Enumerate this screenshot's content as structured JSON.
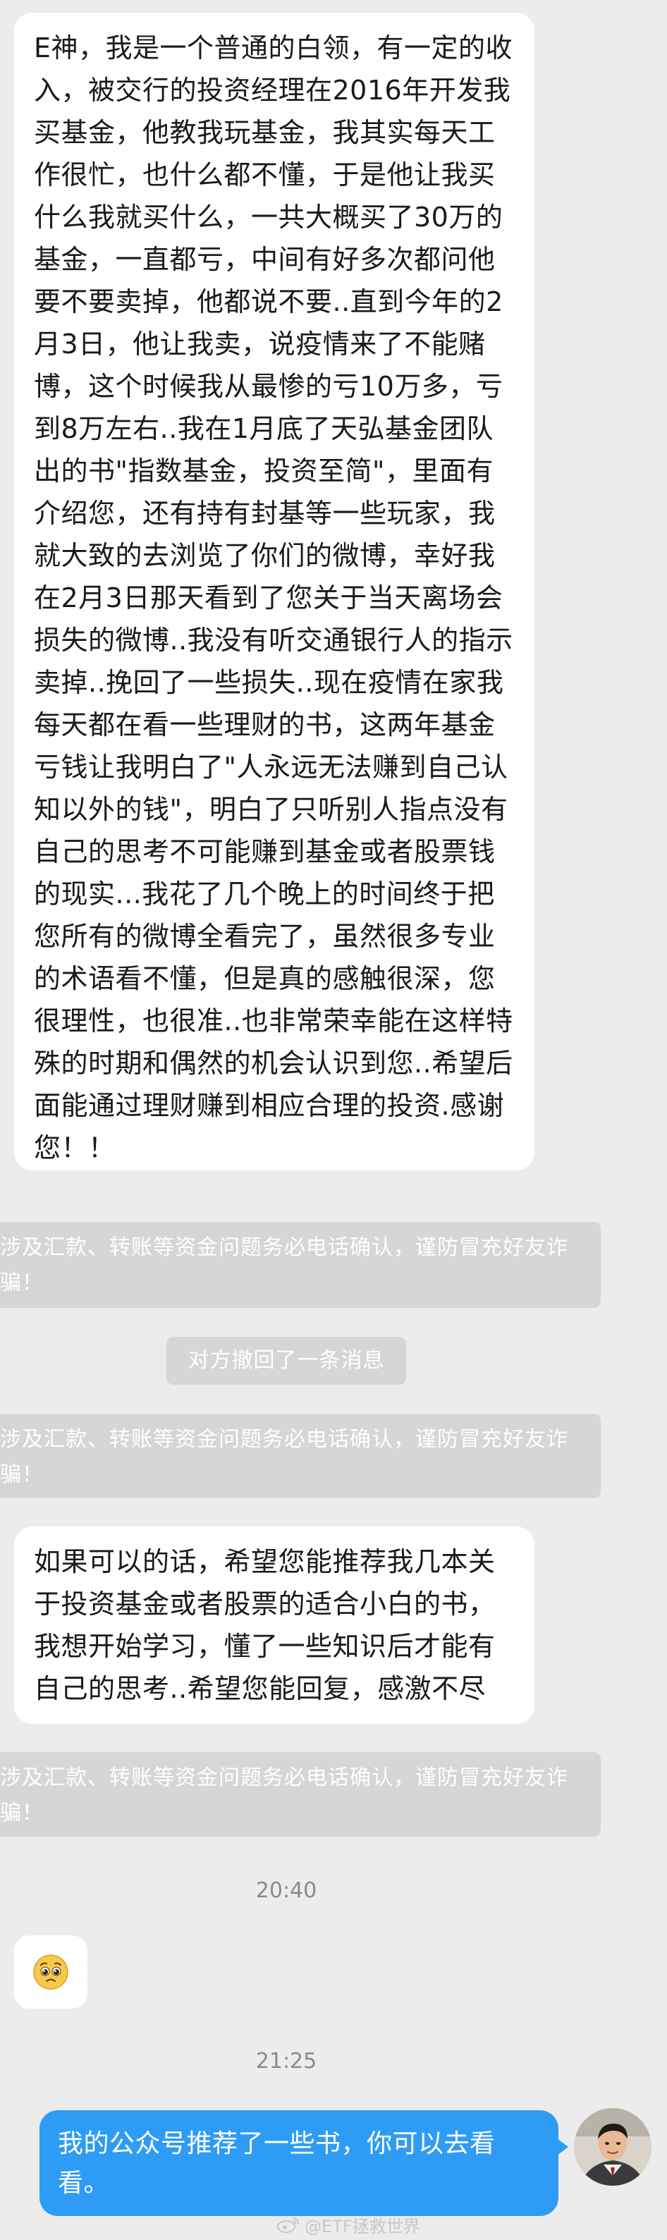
{
  "messages": {
    "m1": "E神，我是一个普通的白领，有一定的收入，被交行的投资经理在2016年开发我买基金，他教我玩基金，我其实每天工作很忙，也什么都不懂，于是他让我买什么我就买什么，一共大概买了30万的基金，一直都亏，中间有好多次都问他要不要卖掉，他都说不要..直到今年的2月3日，他让我卖，说疫情来了不能赌博，这个时候我从最惨的亏10万多，亏到8万左右..我在1月底了天弘基金团队出的书\"指数基金，投资至简\"，里面有介绍您，还有持有封基等一些玩家，我就大致的去浏览了你们的微博，幸好我在2月3日那天看到了您关于当天离场会损失的微博..我没有听交通银行人的指示卖掉..挽回了一些损失..现在疫情在家我每天都在看一些理财的书，这两年基金亏钱让我明白了\"人永远无法赚到自己认知以外的钱\"，明白了只听别人指点没有自己的思考不可能赚到基金或者股票钱的现实...我花了几个晚上的时间终于把您所有的微博全看完了，虽然很多专业的术语看不懂，但是真的感触很深，您很理性，也很准..也非常荣幸能在这样特殊的时期和偶然的机会认识到您..希望后面能通过理财赚到相应合理的投资.感谢您！！",
    "m2": "如果可以的话，希望您能推荐我几本关于投资基金或者股票的适合小白的书，我想开始学习，懂了一些知识后才能有自己的思考..希望您能回复，感激不尽",
    "m3": "我的公众号推荐了一些书，你可以去看看。"
  },
  "notices": {
    "n1": "涉及汇款、转账等资金问题务必电话确认，谨防冒充好友诈骗！",
    "n2": "涉及汇款、转账等资金问题务必电话确认，谨防冒充好友诈骗！",
    "n3": "涉及汇款、转账等资金问题务必电话确认，谨防冒充好友诈骗！"
  },
  "system": {
    "recall": "对方撤回了一条消息"
  },
  "timestamps": {
    "t1": "20:40",
    "t2": "21:25"
  },
  "watermark": {
    "text": "@ETF拯救世界"
  },
  "icons": {
    "emoji": "pleading-face-icon",
    "avatar": "user-avatar",
    "watermark_logo": "weibo-logo-icon"
  },
  "colors": {
    "background": "#ececec",
    "incoming_bubble": "#ffffff",
    "outgoing_bubble": "#2e9cf5",
    "notice_bg": "#d6d6d6",
    "timestamp_text": "#8a8a8a"
  }
}
